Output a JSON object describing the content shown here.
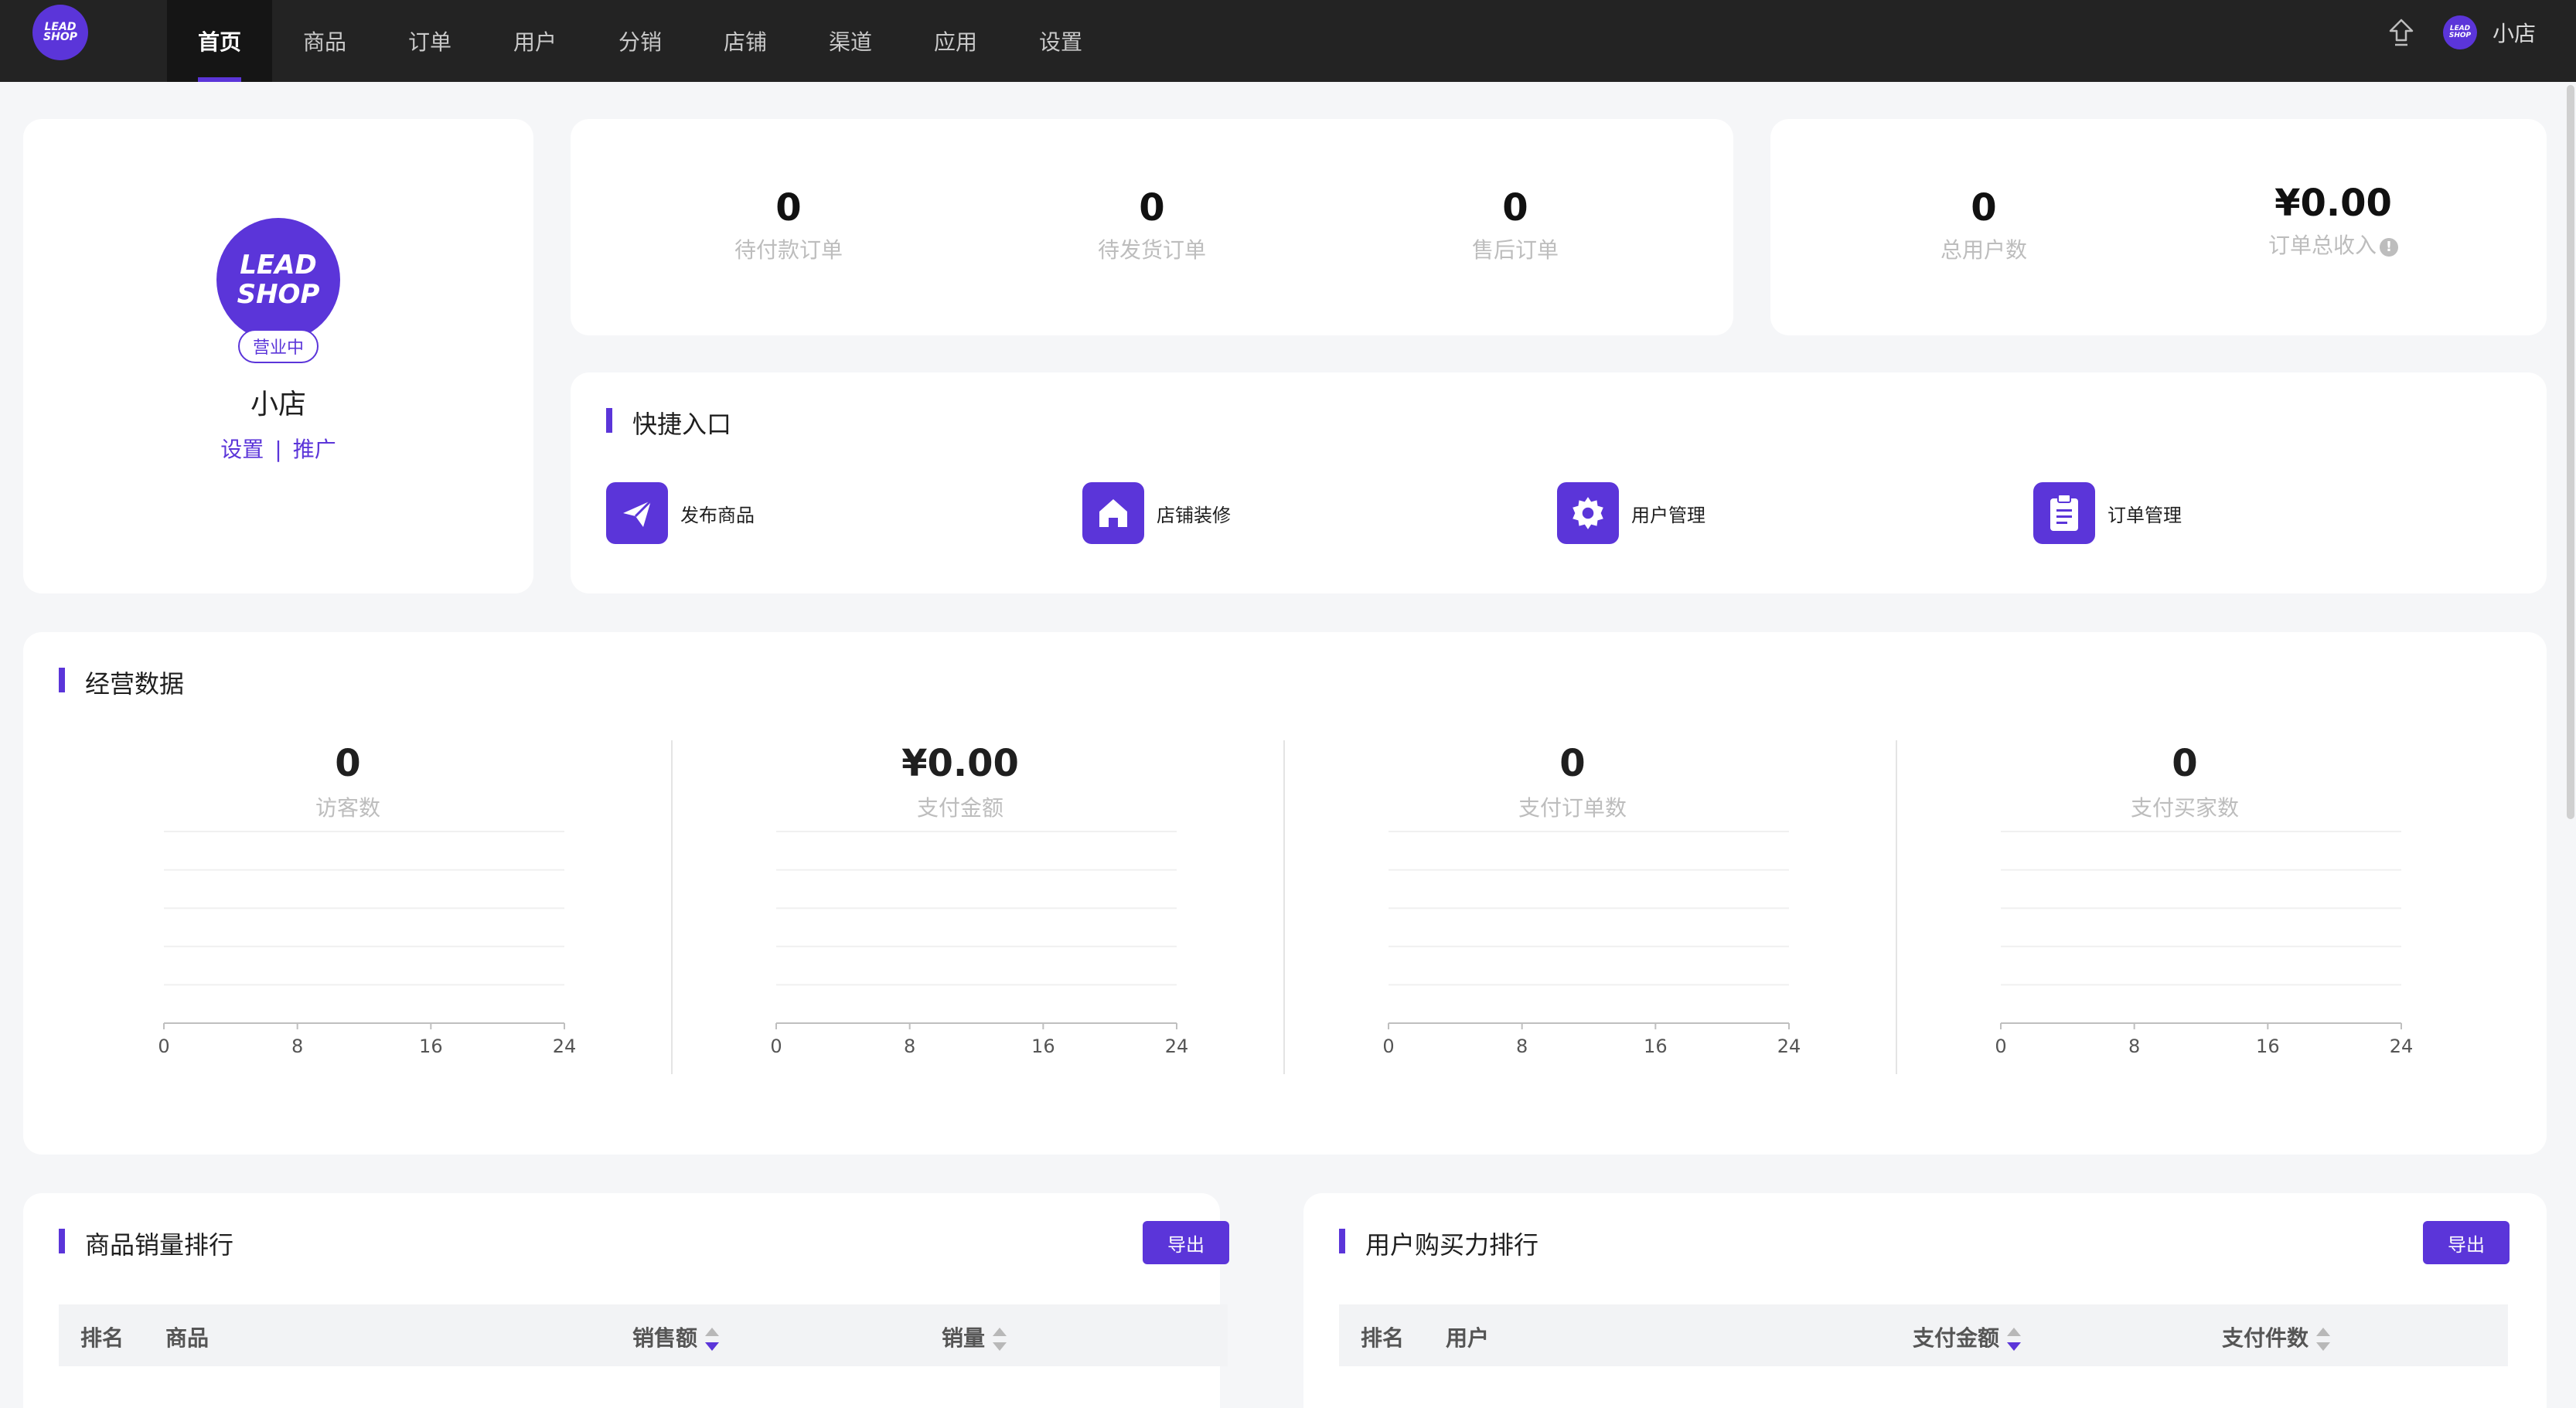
{
  "brand": {
    "logo_text": "LEAD SHOP"
  },
  "nav": {
    "items": [
      "首页",
      "商品",
      "订单",
      "用户",
      "分销",
      "店铺",
      "渠道",
      "应用",
      "设置"
    ],
    "active_index": 0
  },
  "user": {
    "name": "小店",
    "avatar_text": "LEAD SHOP"
  },
  "shop": {
    "logo_line1": "LEAD",
    "logo_line2": "SHOP",
    "status": "营业中",
    "name": "小店",
    "link_settings": "设置",
    "link_separator": "|",
    "link_promote": "推广"
  },
  "order_stats": [
    {
      "value": "0",
      "label": "待付款订单"
    },
    {
      "value": "0",
      "label": "待发货订单"
    },
    {
      "value": "0",
      "label": "售后订单"
    }
  ],
  "user_stats": [
    {
      "value": "0",
      "label": "总用户数"
    },
    {
      "value": "¥0.00",
      "label": "订单总收入"
    }
  ],
  "quick_entry": {
    "title": "快捷入口",
    "items": [
      {
        "label": "发布商品",
        "icon": "paper-plane-icon"
      },
      {
        "label": "店铺装修",
        "icon": "home-icon"
      },
      {
        "label": "用户管理",
        "icon": "gear-icon"
      },
      {
        "label": "订单管理",
        "icon": "clipboard-icon"
      }
    ]
  },
  "business": {
    "title": "经营数据",
    "metrics": [
      {
        "value": "0",
        "label": "访客数"
      },
      {
        "value": "¥0.00",
        "label": "支付金额"
      },
      {
        "value": "0",
        "label": "支付订单数"
      },
      {
        "value": "0",
        "label": "支付买家数"
      }
    ]
  },
  "chart_data": [
    {
      "type": "line",
      "x": [
        0,
        8,
        16,
        24
      ],
      "series": [
        {
          "values": [
            0,
            0,
            0,
            0
          ]
        }
      ],
      "xlabel": "",
      "ylabel": "",
      "grid": true,
      "xticks": [
        "0",
        "8",
        "16",
        "24"
      ]
    },
    {
      "type": "line",
      "x": [
        0,
        8,
        16,
        24
      ],
      "series": [
        {
          "values": [
            0,
            0,
            0,
            0
          ]
        }
      ],
      "xlabel": "",
      "ylabel": "",
      "grid": true,
      "xticks": [
        "0",
        "8",
        "16",
        "24"
      ]
    },
    {
      "type": "line",
      "x": [
        0,
        8,
        16,
        24
      ],
      "series": [
        {
          "values": [
            0,
            0,
            0,
            0
          ]
        }
      ],
      "xlabel": "",
      "ylabel": "",
      "grid": true,
      "xticks": [
        "0",
        "8",
        "16",
        "24"
      ]
    },
    {
      "type": "line",
      "x": [
        0,
        8,
        16,
        24
      ],
      "series": [
        {
          "values": [
            0,
            0,
            0,
            0
          ]
        }
      ],
      "xlabel": "",
      "ylabel": "",
      "grid": true,
      "xticks": [
        "0",
        "8",
        "16",
        "24"
      ]
    }
  ],
  "goods_rank": {
    "title": "商品销量排行",
    "export_label": "导出",
    "columns": [
      "排名",
      "商品",
      "销售额",
      "销量"
    ]
  },
  "user_rank": {
    "title": "用户购买力排行",
    "export_label": "导出",
    "columns": [
      "排名",
      "用户",
      "支付金额",
      "支付件数"
    ]
  },
  "colors": {
    "accent": "#5b35d9",
    "topbar": "#232323",
    "background": "#f5f6f8"
  }
}
